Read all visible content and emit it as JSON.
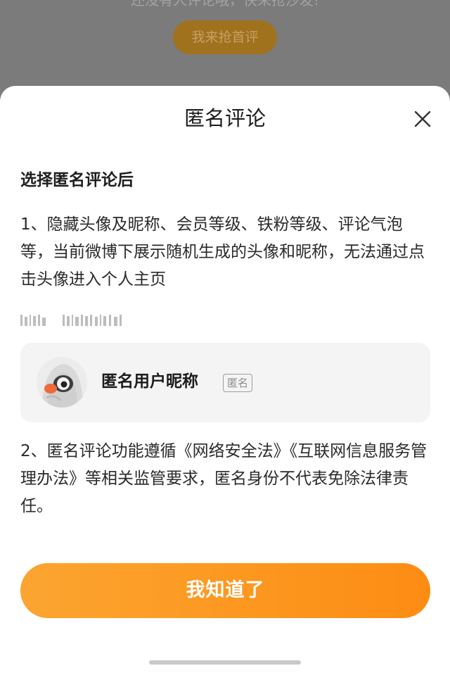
{
  "background": {
    "prompt_text": "还没有人评论哦，快来抢沙发!",
    "first_comment_button": "我来抢首评"
  },
  "dialog": {
    "title": "匿名评论",
    "close_icon": "close-icon",
    "subheading": "选择匿名评论后",
    "paragraph_1": "1、隐藏头像及昵称、会员等级、铁粉等级、评论气泡等，当前微博下展示随机生成的头像和昵称，无法通过点击头像进入个人主页",
    "preview": {
      "nickname": "匿名用户昵称",
      "badge": "匿名"
    },
    "paragraph_2": "2、匿名评论功能遵循《网络安全法》《互联网信息服务管理办法》等相关监管要求，匿名身份不代表免除法律责任。",
    "confirm_button": "我知道了"
  },
  "colors": {
    "accent": "#fd9a22",
    "overlay": "#7c7c7c",
    "sheet": "#ffffff"
  }
}
